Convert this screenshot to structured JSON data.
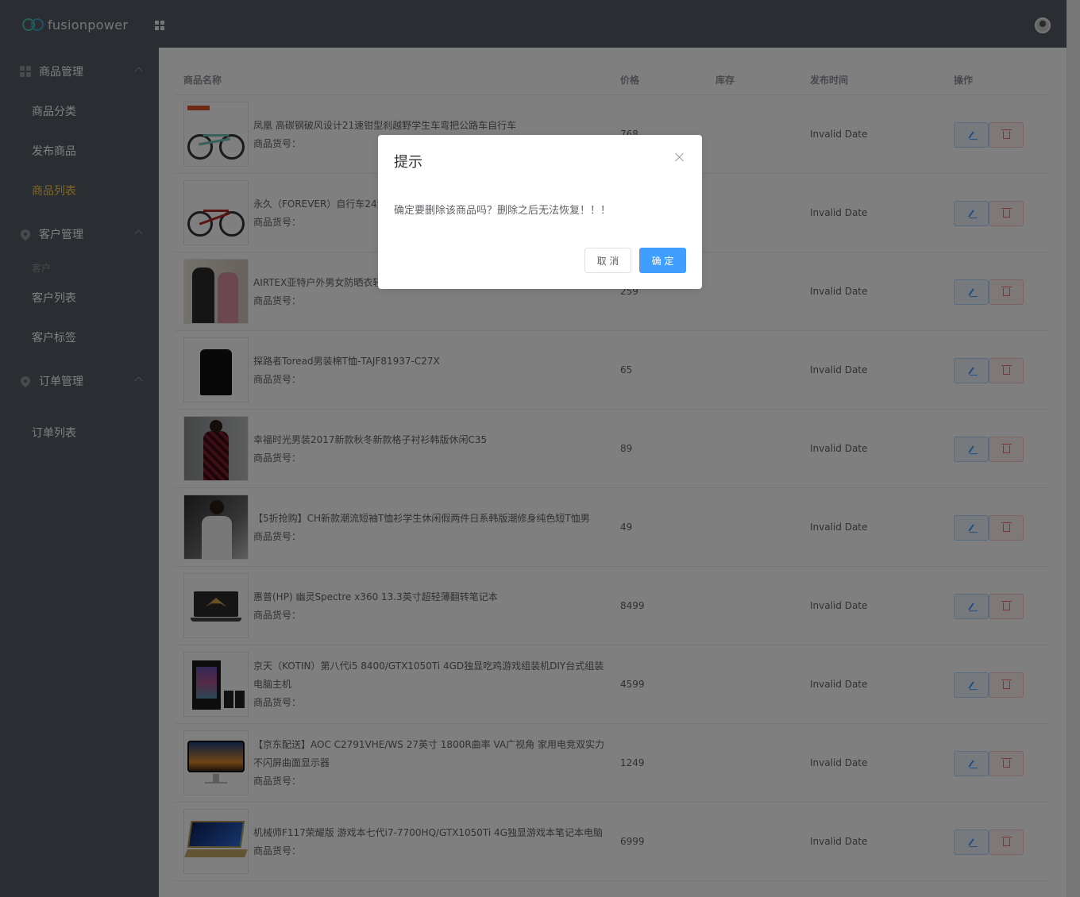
{
  "header": {
    "logo_text": "fusionpower",
    "brand_colors": [
      "#4ec4a8",
      "#3aa7c9"
    ],
    "bg_color": "#545c64"
  },
  "sidebar": {
    "groups": [
      {
        "label": "商品管理",
        "icon": "grid-icon"
      },
      {
        "label": "客户管理",
        "icon": "location-icon"
      },
      {
        "label": "订单管理",
        "icon": "location-icon"
      }
    ],
    "items": [
      {
        "label": "商品分类",
        "active": false
      },
      {
        "label": "发布商品",
        "active": false
      },
      {
        "label": "商品列表",
        "active": true
      },
      {
        "label": "客户列表",
        "active": false
      },
      {
        "label": "客户标签",
        "active": false
      },
      {
        "label": "订单列表",
        "active": false
      }
    ],
    "sub_title": "客户",
    "active_color": "#ffd04b"
  },
  "table": {
    "headers": [
      "商品名称",
      "价格",
      "库存",
      "发布时间",
      "操作"
    ],
    "sku_label": "商品货号：",
    "rows": [
      {
        "title": "凤凰 高碳钢破风设计21速钳型刹越野学生车弯把公路车自行车",
        "price": "768",
        "date": "Invalid Date",
        "image": "bike-green"
      },
      {
        "title": "永久（FOREVER）自行车24速",
        "price": "",
        "date": "Invalid Date",
        "image": "bike-red"
      },
      {
        "title": "AIRTEX亚特户外男女防晒衣轻",
        "price": "259",
        "date": "Invalid Date",
        "image": "couple-jackets"
      },
      {
        "title": "探路者Toread男装棉T恤-TAJF81937-C27X",
        "price": "65",
        "date": "Invalid Date",
        "image": "black-tshirt"
      },
      {
        "title": "幸福时光男装2017新款秋冬新款格子衬衫韩版休闲C35",
        "price": "89",
        "date": "Invalid Date",
        "image": "plaid-shirt"
      },
      {
        "title": "【5折抢购】CH新款潮流短袖T恤衫学生休闲假两件日系韩版潮修身纯色短T恤男",
        "price": "49",
        "date": "Invalid Date",
        "image": "white-tshirt"
      },
      {
        "title": "惠普(HP) 幽灵Spectre x360 13.3英寸超轻薄翻转笔记本",
        "price": "8499",
        "date": "Invalid Date",
        "image": "hp-laptop"
      },
      {
        "title": "京天（KOTIN）第八代i5 8400/GTX1050Ti 4GD独显吃鸡游戏组装机DIY台式组装电脑主机",
        "price": "4599",
        "date": "Invalid Date",
        "image": "gaming-pc"
      },
      {
        "title": "【京东配送】AOC C2791VHE/WS 27英寸 1800R曲率 VA广视角 家用电竞双实力不闪屏曲面显示器",
        "price": "1249",
        "date": "Invalid Date",
        "image": "curved-monitor"
      },
      {
        "title": "机械师F117荣耀版 游戏本七代i7-7700HQ/GTX1050Ti 4G独显游戏本笔记本电脑",
        "price": "6999",
        "date": "Invalid Date",
        "image": "gaming-laptop"
      }
    ]
  },
  "dialog": {
    "title": "提示",
    "message": "确定要删除该商品吗？删除之后无法恢复！！！",
    "cancel_label": "取 消",
    "confirm_label": "确 定",
    "confirm_color": "#409eff"
  }
}
